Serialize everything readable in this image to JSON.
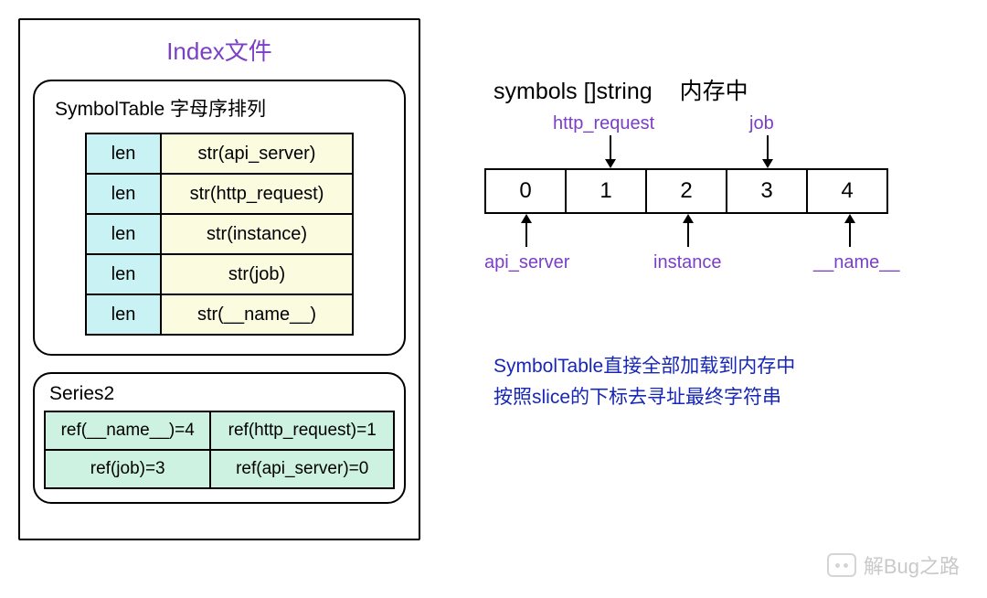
{
  "index_file": {
    "title": "Index文件",
    "symbol_table": {
      "title": "SymbolTable 字母序排列",
      "rows": [
        {
          "len": "len",
          "str": "str(api_server)"
        },
        {
          "len": "len",
          "str": "str(http_request)"
        },
        {
          "len": "len",
          "str": "str(instance)"
        },
        {
          "len": "len",
          "str": "str(job)"
        },
        {
          "len": "len",
          "str": "str(__name__)"
        }
      ]
    },
    "series2": {
      "title": "Series2",
      "cells": [
        [
          "ref(__name__)=4",
          "ref(http_request)=1"
        ],
        [
          "ref(job)=3",
          "ref(api_server)=0"
        ]
      ]
    }
  },
  "memory": {
    "heading_left": "symbols []string",
    "heading_right": "内存中",
    "cells": [
      "0",
      "1",
      "2",
      "3",
      "4"
    ],
    "top_labels": {
      "i1": "http_request",
      "i3": "job"
    },
    "bottom_labels": {
      "i0": "api_server",
      "i2": "instance",
      "i4": "__name__"
    },
    "note_line1": "SymbolTable直接全部加载到内存中",
    "note_line2": "按照slice的下标去寻址最终字符串"
  },
  "watermark": "解Bug之路"
}
